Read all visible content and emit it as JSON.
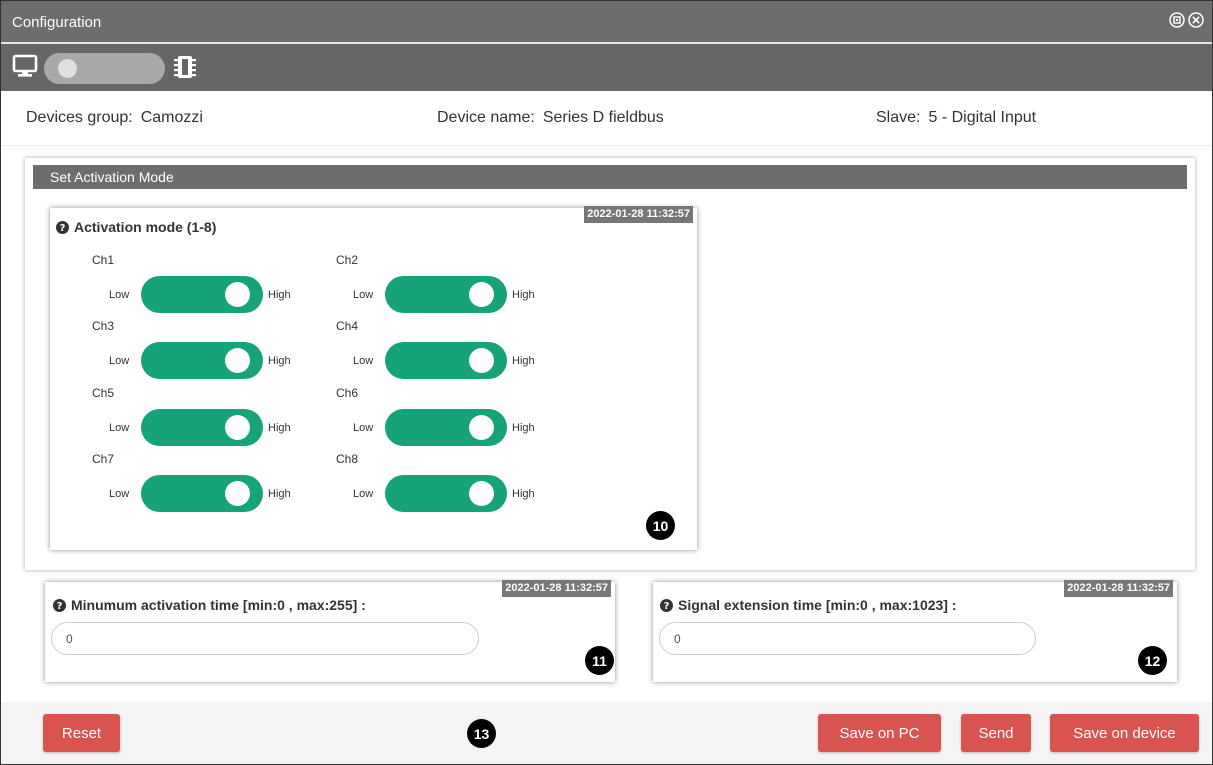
{
  "window": {
    "title": "Configuration",
    "controls": [
      {
        "icon": "maximize-circle-icon"
      },
      {
        "icon": "close-circle-icon"
      }
    ]
  },
  "toolbar": {
    "left_icon": "monitor-icon",
    "right_icon": "chip-icon",
    "toggle_state": "off"
  },
  "info": {
    "devices_group_label": "Devices group:",
    "devices_group_value": "Camozzi",
    "device_name_label": "Device name:",
    "device_name_value": "Series D fieldbus",
    "slave_label": "Slave:",
    "slave_value": "5 - Digital Input"
  },
  "section": {
    "title": "Set Activation Mode"
  },
  "activation_card": {
    "title": "Activation mode (1-8)",
    "timestamp": "2022-01-28 11:32:57",
    "badge": "10",
    "low_label": "Low",
    "high_label": "High",
    "channels": [
      {
        "label": "Ch1",
        "state": "High"
      },
      {
        "label": "Ch2",
        "state": "High"
      },
      {
        "label": "Ch3",
        "state": "High"
      },
      {
        "label": "Ch4",
        "state": "High"
      },
      {
        "label": "Ch5",
        "state": "High"
      },
      {
        "label": "Ch6",
        "state": "High"
      },
      {
        "label": "Ch7",
        "state": "High"
      },
      {
        "label": "Ch8",
        "state": "High"
      }
    ]
  },
  "min_activation_card": {
    "title": "Minumum activation time [min:0 , max:255] :",
    "timestamp": "2022-01-28 11:32:57",
    "value": "0",
    "badge": "11"
  },
  "signal_extension_card": {
    "title": "Signal extension time [min:0 , max:1023] :",
    "timestamp": "2022-01-28 11:32:57",
    "value": "0",
    "badge": "12"
  },
  "footer": {
    "reset_label": "Reset",
    "badge": "13",
    "save_pc_label": "Save on PC",
    "send_label": "Send",
    "save_device_label": "Save on device"
  },
  "colors": {
    "header_gray": "#6d6d6d",
    "switch_green": "#16a37a",
    "button_red": "#d9534f"
  }
}
